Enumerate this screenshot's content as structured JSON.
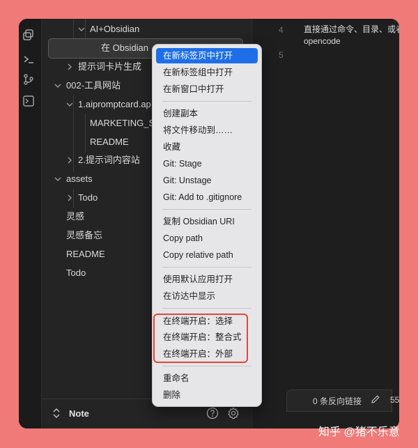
{
  "file_tree": {
    "ai_obsidian_folder": "AI+Obsidian",
    "selected_item": "在 Obsidian",
    "prompt_card_folder": "提示词卡片生成",
    "tools_folder": "002-工具网站",
    "aipromptcard_folder": "1.aipromptcard.ap",
    "marketing_file": "MARKETING_S",
    "readme_file_nested": "README",
    "prompt_station_folder": "2.提示词内容站",
    "assets_folder": "assets",
    "todo_folder": "Todo",
    "inspiration_file": "灵感",
    "inspiration_memo_file": "灵感备忘",
    "readme_file": "README",
    "todo_file": "Todo"
  },
  "note_bar": {
    "label": "Note"
  },
  "editor": {
    "line_numbers": [
      "4",
      "5"
    ],
    "line4_text": "直接通过命令、目录、或者",
    "line4_wrap": "opencode"
  },
  "status_bar": {
    "backlinks": "0 条反向链接",
    "count": "55"
  },
  "context_menu": {
    "open_new_tab": "在新标签页中打开",
    "open_new_tab_group": "在新标签组中打开",
    "open_new_window": "在新窗口中打开",
    "make_copy": "创建副本",
    "move_file": "将文件移动到……",
    "bookmark": "收藏",
    "git_stage": "Git: Stage",
    "git_unstage": "Git: Unstage",
    "git_add_gitignore": "Git: Add to .gitignore",
    "copy_obsidian_uri": "复制 Obsidian URI",
    "copy_path": "Copy path",
    "copy_relative_path": "Copy relative path",
    "open_default_app": "使用默认应用打开",
    "reveal_finder": "在访达中显示",
    "terminal_select": "在终端开启：选择",
    "terminal_integrated": "在终端开启：整合式",
    "terminal_external": "在终端开启：外部",
    "rename": "重命名",
    "delete": "删除"
  },
  "watermark": "知乎 @猪不乐意",
  "colors": {
    "background": "#f07a77",
    "highlight": "#1e6ee8",
    "annotation_box": "#e8443a"
  }
}
